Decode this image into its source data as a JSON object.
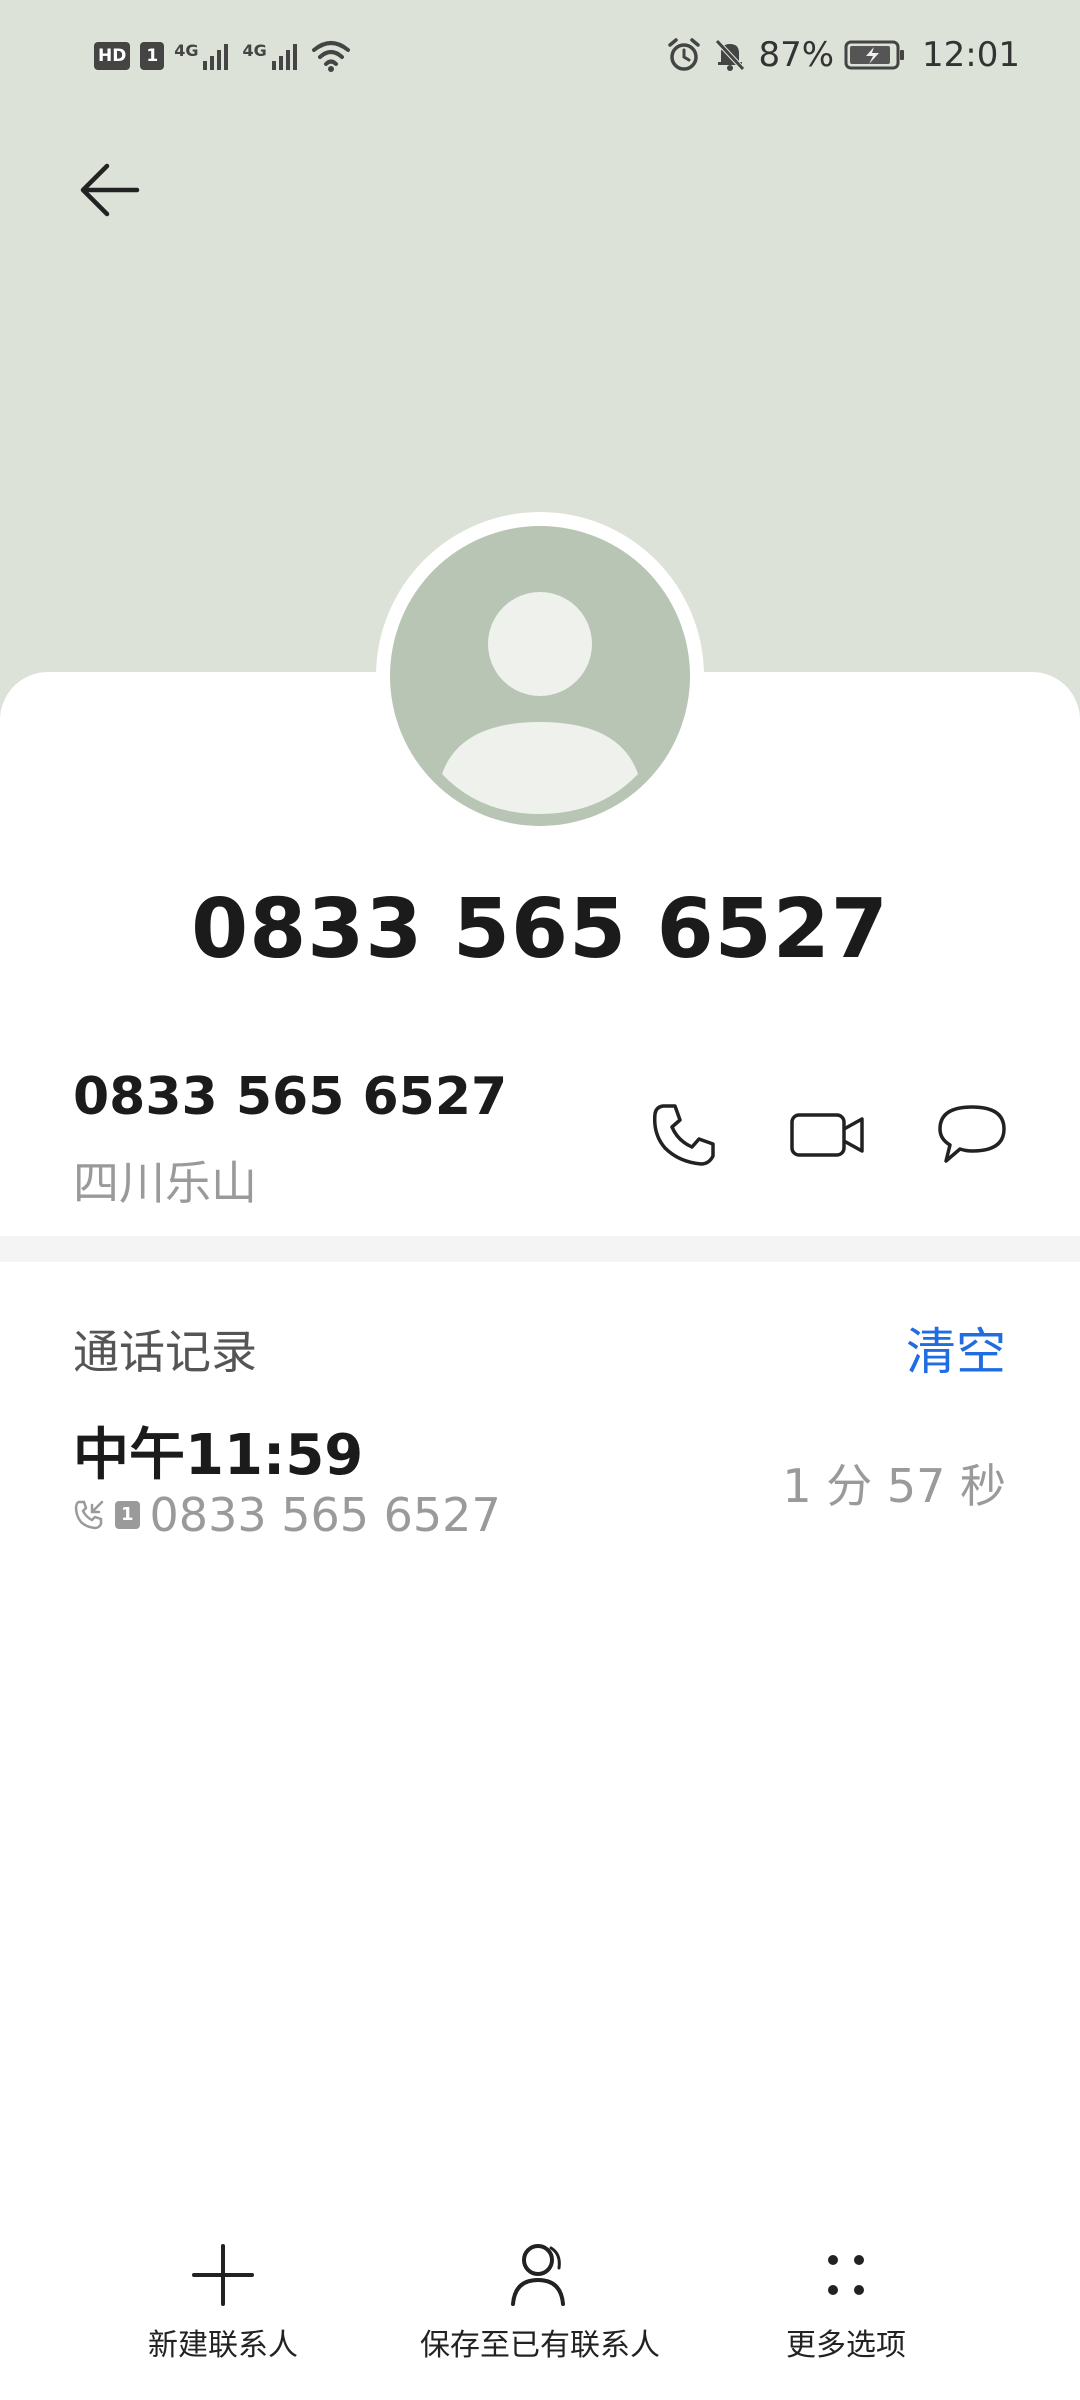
{
  "status_bar": {
    "hd_badge": "HD",
    "sim1_badge": "1",
    "net1": "4G",
    "net2": "4G",
    "battery_percent": "87%",
    "time": "12:01"
  },
  "contact": {
    "title_number": "0833 565 6527",
    "phone_number": "0833 565 6527",
    "location": "四川乐山"
  },
  "call_log": {
    "section_title": "通话记录",
    "clear_label": "清空",
    "items": [
      {
        "time": "中午11:59",
        "sim": "1",
        "number": "0833 565 6527",
        "duration": "1 分 57 秒"
      }
    ]
  },
  "bottom_bar": {
    "new_contact": "新建联系人",
    "save_existing": "保存至已有联系人",
    "more_options": "更多选项"
  },
  "colors": {
    "header_bg": "#dce2d8",
    "avatar_bg": "#b8c4b4",
    "accent_blue": "#1f6de0"
  },
  "icons": {
    "back": "arrow-left-icon",
    "call": "phone-icon",
    "video": "video-call-icon",
    "message": "message-icon",
    "incoming": "incoming-call-icon",
    "new_contact": "plus-icon",
    "save_existing": "person-icon",
    "more": "more-dots-icon"
  }
}
